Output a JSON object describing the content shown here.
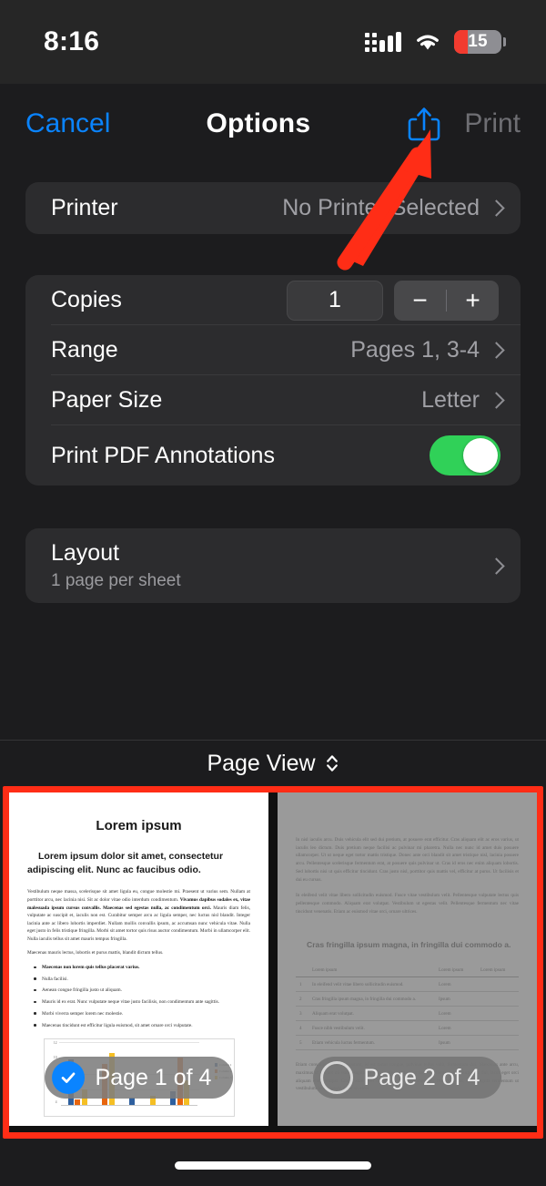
{
  "status_bar": {
    "time": "8:16",
    "battery_percent": "15",
    "icons": [
      "cellular-signal-icon",
      "wifi-icon",
      "battery-icon"
    ]
  },
  "nav_bar": {
    "cancel_label": "Cancel",
    "title": "Options",
    "share_icon": "share-icon",
    "print_label": "Print",
    "print_enabled": false
  },
  "settings": {
    "printer": {
      "label": "Printer",
      "value": "No Printer Selected"
    },
    "copies": {
      "label": "Copies",
      "value": "1",
      "decrement": "−",
      "increment": "+"
    },
    "range": {
      "label": "Range",
      "value": "Pages 1, 3-4"
    },
    "paper_size": {
      "label": "Paper Size",
      "value": "Letter"
    },
    "annotations": {
      "label": "Print PDF Annotations",
      "state": "on"
    },
    "layout": {
      "label": "Layout",
      "sub": "1 page per sheet"
    }
  },
  "page_view": {
    "label": "Page View",
    "selector_icon": "up-down-chevron-icon"
  },
  "thumbnails": [
    {
      "badge": "Page 1 of 4",
      "selected": true,
      "badge_icon": "checkmark-circle-icon",
      "title": "Lorem ipsum",
      "lead": "Lorem ipsum dolor sit amet, consectetur adipiscing elit. Nunc ac faucibus odio.",
      "paragraph_1a": "Vestibulum neque massa, scelerisque sit amet ligula eu, congue molestie mi. Praesent ut varius sem. Nullam at porttitor arcu, nec lacinia nisi. Sit ac dolor vitae odio interdum condimentum. ",
      "paragraph_1b": "Vivamus dapibus sodales ex, vitae malesuada ipsum cursus convallis. Maecenas sed egestas nulla, ac condimentum orci.",
      "paragraph_1c": " Mauris diam felis, vulputate ac suscipit et, iaculis non est. Curabitur semper arcu ac ligula semper, nec luctus nisl blandit. Integer lacinia ante ac libero lobortis imperdiet. Nullam mollis convallis ipsum, ac accumsan nunc vehicula vitae. Nulla eget justo in felis tristique fringilla. Morbi sit amet tortor quis risus auctor condimentum. Morbi in ullamcorper elit. Nulla iaculis tellus sit amet mauris tempus fringilla.",
      "paragraph_2": "Maecenas mauris lectus, lobortis et purus mattis, blandit dictum tellus.",
      "bullets": [
        "Maecenas non lorem quis tellus placerat varius.",
        "Nulla facilisi.",
        "Aenean congue fringilla justo ut aliquam.",
        "Mauris id ex erat. Nunc vulputate neque vitae justo facilisis, non condimentum ante sagittis.",
        "Morbi viverra semper lorem nec molestie.",
        "Maecenas tincidunt est efficitur ligula euismod, sit amet ornare orci vulputate."
      ],
      "chart": {
        "legend": [
          "Column 1",
          "Column 2",
          "Column 3"
        ],
        "y_ticks": [
          "12",
          "10",
          "8",
          "6",
          "4"
        ]
      }
    },
    {
      "badge": "Page 2 of 4",
      "selected": false,
      "badge_icon": "empty-circle-icon",
      "paragraph_1": "In nisl iaculis arcu. Duis vehicula elit sed dui pretium, at posuere erat efficitur. Cras aliquam elit ac eros varius, ut iaculis leo dictum. Duis pretium neque facilisi ac pulvinar mi pharetra. Nulla nec nunc id amet duis posuere ullamcorper. Ut ut neque eget tortor mattis tristique. Donec ante orci blandit sit amet tristique nisl, lacinia posuere arcu. Pellentesque scelerisque fermentum erat, at posuere quis pulvinar ut. Cras id eros nec enim aliquam lobortis. Sed lobortis nisi ut quis efficitur tincidunt. Cras justo nisl, porttitor quis mattis vel, efficitur at purus. Ut facilisis et dui eu cursus.",
      "paragraph_2": "In eleifend velit vitae libero sollicitudin euismod. Fusce vitae vestibulum velit. Pellentesque vulputate lectus quis pellentesque commodo. Aliquam erat volutpat. Vestibulum ut egestas velit. Pellentesque fermentum nec vitae tincidunt venenatis. Etiam ac euismod vitae orci, ornare ultrices.",
      "heading": "Cras fringilla ipsum magna, in fringilla dui commodo a.",
      "table": {
        "headers": [
          "",
          "Lorem ipsum",
          "Lorem ipsum",
          "Lorem ipsum"
        ],
        "rows": [
          [
            "1",
            "In eleifend velit vitae libero sollicitudin euismod.",
            "Lorem",
            ""
          ],
          [
            "2",
            "Cras fringilla ipsum magna, in fringilla dui commodo a.",
            "Ipsum",
            ""
          ],
          [
            "3",
            "Aliquam erat volutpat.",
            "Lorem",
            ""
          ],
          [
            "4",
            "Fusce nibh vestibulum velit.",
            "Lorem",
            ""
          ],
          [
            "5",
            "Etiam vehicula luctus fermentum.",
            "Ipsum",
            ""
          ]
        ]
      },
      "paragraph_3": "Etiam convallis luctus fermentum, id est tortor congue, pulvinar tellus velit, fermentum dui. Maecenas ante arcu, maximus ut aliquet mi enim, sagittis a mauris, tincidunt dolor lorem pellentesque ut turpissim dui, lacus eget orci aliquam erat volutpat. Cras ipsum velit cursus, sit amet tincidunt nec blandit lectus, sed fringilla fermentum ut vestibulum lorem ipsum dolor sit amet."
    }
  ],
  "annotation": {
    "arrow": "red-arrow-pointing-to-share-icon",
    "arrow_color": "#ff2d16",
    "highlight_box_color": "#ff2d16"
  },
  "colors": {
    "accent_blue": "#0a84ff",
    "toggle_green": "#30d158",
    "background": "#1c1c1e",
    "card": "#2c2c2e",
    "disabled_text": "#6e6e73"
  }
}
